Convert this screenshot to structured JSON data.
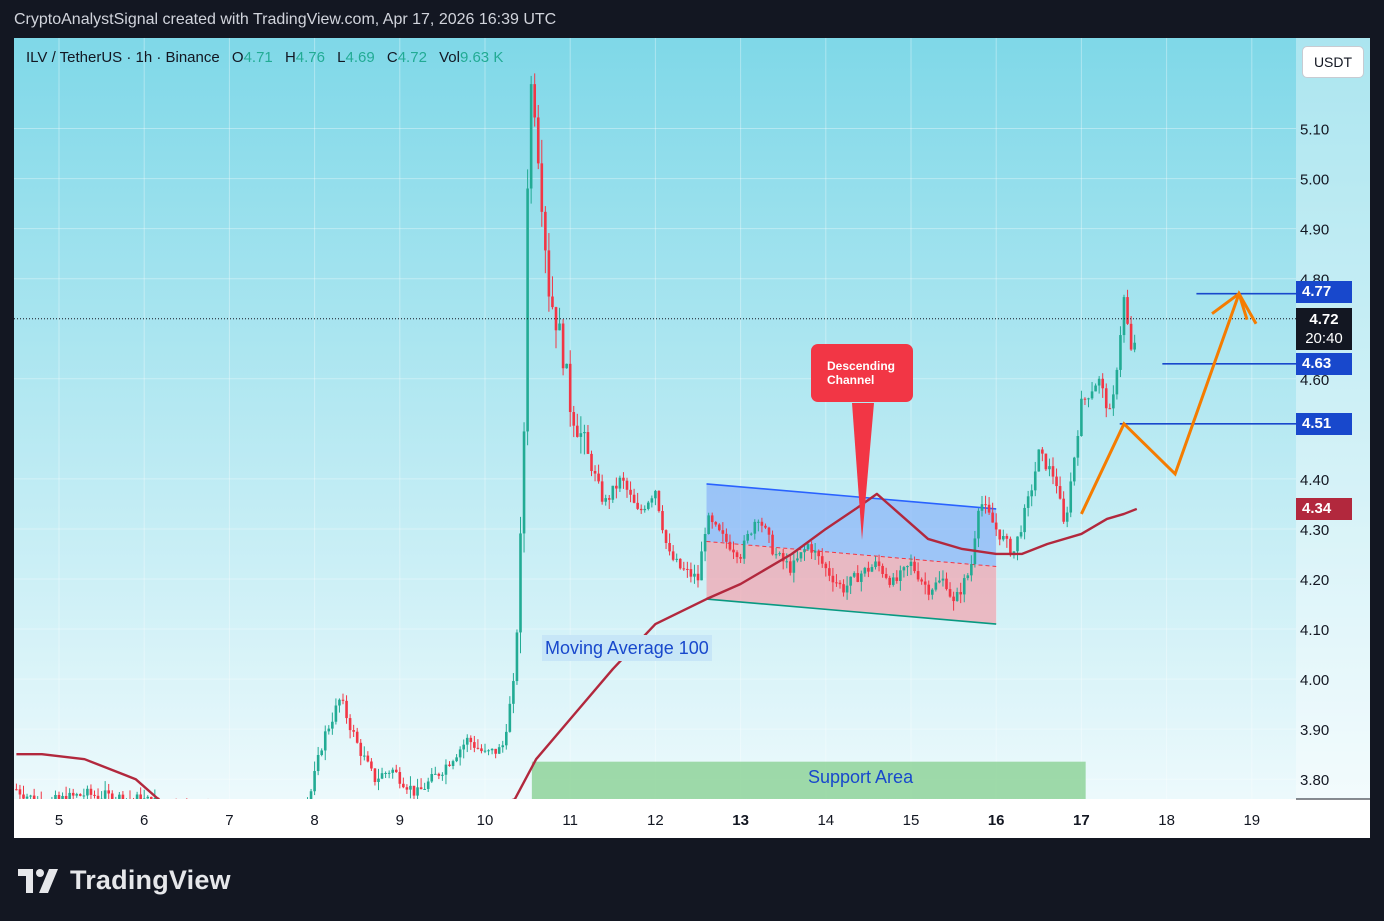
{
  "header": {
    "caption": "CryptoAnalystSignal created with TradingView.com, Apr 17, 2026 16:39 UTC"
  },
  "legend": {
    "symbol": "ILV / TetherUS · 1h · Binance",
    "o_label": "O",
    "o_value": "4.71",
    "h_label": "H",
    "h_value": "4.76",
    "l_label": "L",
    "l_value": "4.69",
    "c_label": "C",
    "c_value": "4.72",
    "vol_label": "Vol",
    "vol_value": "9.63 K"
  },
  "currency_button": "USDT",
  "price_axis": {
    "ticks": [
      "5.10",
      "5.00",
      "4.90",
      "4.80",
      "4.60",
      "4.40",
      "4.30",
      "4.20",
      "4.10",
      "4.00",
      "3.90",
      "3.80"
    ],
    "current_price": "4.72",
    "countdown": "20:40",
    "level_tags": [
      "4.77",
      "4.63",
      "4.51"
    ],
    "ma_tag": "4.34"
  },
  "time_axis": {
    "ticks": [
      "5",
      "6",
      "7",
      "8",
      "9",
      "10",
      "11",
      "12",
      "13",
      "14",
      "15",
      "16",
      "17",
      "18",
      "19"
    ]
  },
  "annotations": {
    "callout_line1": "Descending",
    "callout_line2": "Channel",
    "ma_label": "Moving Average 100",
    "support_label": "Support Area"
  },
  "footer": {
    "brand": "TradingView"
  },
  "colors": {
    "bull": "#22ab94",
    "bear": "#f23645",
    "ma": "#b2283d",
    "level": "#1848cc",
    "arrow": "#f57c00",
    "channel_fill": "#8ab4f8",
    "support_fill": "#8fd49a",
    "bg_top": "#7fd8e8",
    "bg_bottom": "#f2fbfd"
  },
  "chart_data": {
    "type": "candlestick",
    "ylim": [
      3.76,
      5.2
    ],
    "x_unit": "day of month (April)",
    "xlim": [
      4.5,
      19.4
    ],
    "key_levels": [
      4.77,
      4.63,
      4.51
    ],
    "moving_average_100": {
      "name": "Moving Average 100",
      "x": [
        4.5,
        4.8,
        5.3,
        5.9,
        6.3,
        10.0,
        10.35,
        10.6,
        11.0,
        11.5,
        12.0,
        12.6,
        13.0,
        13.6,
        14.0,
        14.35,
        14.6,
        14.8,
        15.2,
        15.6,
        16.0,
        16.3,
        16.6,
        17.0,
        17.3,
        17.5,
        17.65
      ],
      "y": [
        3.85,
        3.85,
        3.84,
        3.8,
        3.74,
        3.74,
        3.76,
        3.84,
        3.92,
        4.02,
        4.11,
        4.16,
        4.19,
        4.25,
        4.3,
        4.34,
        4.37,
        4.34,
        4.28,
        4.26,
        4.25,
        4.25,
        4.27,
        4.29,
        4.32,
        4.33,
        4.34
      ]
    },
    "descending_channel": {
      "upper": [
        [
          12.6,
          4.39
        ],
        [
          16.0,
          4.34
        ]
      ],
      "lower": [
        [
          12.6,
          4.16
        ],
        [
          16.0,
          4.11
        ]
      ],
      "mid": [
        [
          12.6,
          4.275
        ],
        [
          16.0,
          4.225
        ]
      ]
    },
    "support_area": {
      "x0": 10.55,
      "x1": 17.05,
      "y0": 3.76,
      "y1": 3.835
    },
    "projection_path": [
      [
        17.0,
        4.33
      ],
      [
        17.5,
        4.51
      ],
      [
        18.1,
        4.41
      ],
      [
        18.85,
        4.77
      ],
      [
        19.05,
        4.71
      ]
    ],
    "price_path": {
      "x": [
        4.5,
        4.8,
        5.3,
        5.9,
        6.3,
        7.0,
        7.7,
        7.95,
        8.1,
        8.3,
        8.5,
        8.7,
        8.9,
        9.2,
        9.5,
        9.8,
        10.0,
        10.2,
        10.35,
        10.45,
        10.5,
        10.55,
        10.65,
        10.75,
        10.9,
        11.0,
        11.2,
        11.4,
        11.6,
        11.8,
        12.0,
        12.15,
        12.3,
        12.5,
        12.6,
        12.8,
        13.0,
        13.2,
        13.4,
        13.6,
        13.8,
        14.0,
        14.2,
        14.4,
        14.6,
        14.8,
        15.0,
        15.2,
        15.4,
        15.5,
        15.7,
        15.8,
        16.0,
        16.2,
        16.4,
        16.5,
        16.7,
        16.8,
        17.0,
        17.2,
        17.35,
        17.5,
        17.6,
        17.65
      ],
      "y": [
        3.78,
        3.75,
        3.77,
        3.76,
        3.75,
        3.72,
        3.72,
        3.77,
        3.88,
        3.96,
        3.87,
        3.8,
        3.82,
        3.77,
        3.82,
        3.88,
        3.85,
        3.86,
        4.0,
        4.4,
        5.0,
        5.22,
        5.0,
        4.78,
        4.67,
        4.55,
        4.45,
        4.35,
        4.4,
        4.33,
        4.38,
        4.25,
        4.22,
        4.2,
        4.32,
        4.28,
        4.25,
        4.33,
        4.25,
        4.22,
        4.27,
        4.22,
        4.18,
        4.21,
        4.23,
        4.19,
        4.23,
        4.18,
        4.2,
        4.15,
        4.22,
        4.36,
        4.3,
        4.25,
        4.37,
        4.45,
        4.4,
        4.3,
        4.55,
        4.6,
        4.52,
        4.76,
        4.63,
        4.72
      ]
    }
  }
}
